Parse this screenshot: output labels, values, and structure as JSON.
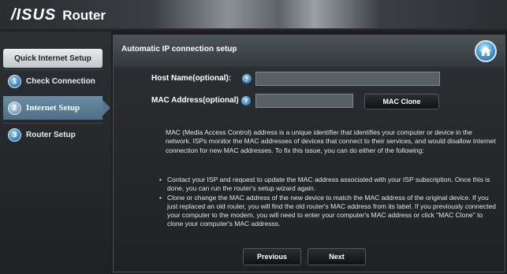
{
  "header": {
    "brand": "/ISUS",
    "product": "Router"
  },
  "sidebar": {
    "title": "Quick Internet Setup",
    "items": [
      {
        "step": "1",
        "label": "Check Connection",
        "active": false
      },
      {
        "step": "2",
        "label": "Internet Setup",
        "active": true
      },
      {
        "step": "3",
        "label": "Router Setup",
        "active": false
      }
    ]
  },
  "main": {
    "title": "Automatic IP connection setup",
    "home_icon": "home-icon",
    "host_name": {
      "label": "Host Name(optional):",
      "value": "",
      "help": "?"
    },
    "mac_address": {
      "label": "MAC Address(optional)",
      "value": "",
      "help": "?"
    },
    "mac_clone_label": "MAC Clone",
    "description": "MAC (Media Access Control) address is a unique identifier that identifies your computer or device in the network. ISPs monitor the MAC addresses of devices that connect to their services, and would disallow Internet connection for new MAC addresses. To fix this issue, you can do either of the following:",
    "bullets": [
      "Contact your ISP and request to update the MAC address associated with your ISP subscription. Once this is done, you can run the router's setup wizard again.",
      "Clone or change the MAC address of the new device to match the MAC address of the original device. If you just replaced an old router, you will find the old router's MAC address from its label. If you previously connected your computer to the modem, you will need to enter your computer's MAC address or click \"MAC Clone\" to clone your computer's MAC addresss."
    ],
    "previous_label": "Previous",
    "next_label": "Next"
  },
  "colors": {
    "active_step": "#56768c",
    "accent_blue": "#3f87c0",
    "panel_bg": "#1f2224"
  }
}
